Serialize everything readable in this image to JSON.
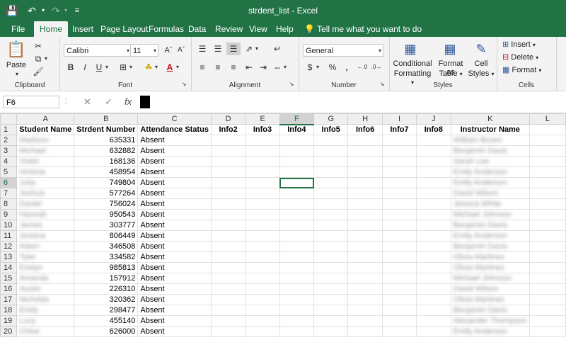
{
  "title": "strdent_list  -  Excel",
  "tabs": [
    "File",
    "Home",
    "Insert",
    "Page Layout",
    "Formulas",
    "Data",
    "Review",
    "View",
    "Help"
  ],
  "active_tab": "Home",
  "tell_me": "Tell me what you want to do",
  "ribbon": {
    "clipboard": {
      "paste": "Paste",
      "label": "Clipboard"
    },
    "font": {
      "name": "Calibri",
      "size": "11",
      "label": "Font"
    },
    "alignment": {
      "label": "Alignment"
    },
    "number": {
      "format": "General",
      "label": "Number",
      "currency": "$",
      "percent": "%",
      "comma": ","
    },
    "styles": {
      "conditional": "Conditional",
      "formatting": "Formatting",
      "format_as": "Format as",
      "table": "Table",
      "cell": "Cell",
      "styles_label": "Styles",
      "label": "Styles"
    },
    "cells": {
      "insert": "Insert",
      "delete": "Delete",
      "format": "Format",
      "label": "Cells"
    }
  },
  "name_box": "F6",
  "columns": [
    "A",
    "B",
    "C",
    "D",
    "E",
    "F",
    "G",
    "H",
    "I",
    "J",
    "K",
    "L"
  ],
  "selected_column": "F",
  "selected_row": 6,
  "headers": [
    "Student Name",
    "Strdent Number",
    "Attendance Status",
    "Info2",
    "Info3",
    "Info4",
    "Info5",
    "Info6",
    "Info7",
    "Info8",
    "Instructor Name",
    ""
  ],
  "rows": [
    {
      "n": 2,
      "name": "Madison",
      "num": "635331",
      "status": "Absent",
      "instr": "William Brown"
    },
    {
      "n": 3,
      "name": "Michael",
      "num": "632882",
      "status": "Absent",
      "instr": "Benjamin Davis"
    },
    {
      "n": 4,
      "name": "Violet",
      "num": "168136",
      "status": "Absent",
      "instr": "Sarah Lee"
    },
    {
      "n": 5,
      "name": "Victoria",
      "num": "458954",
      "status": "Absent",
      "instr": "Emily Anderson"
    },
    {
      "n": 6,
      "name": "Julia",
      "num": "749804",
      "status": "Absent",
      "instr": "Emily Anderson"
    },
    {
      "n": 7,
      "name": "Joshua",
      "num": "577264",
      "status": "Absent",
      "instr": "David Wilson"
    },
    {
      "n": 8,
      "name": "Daniel",
      "num": "756024",
      "status": "Absent",
      "instr": "Jessica White"
    },
    {
      "n": 9,
      "name": "Hannah",
      "num": "950543",
      "status": "Absent",
      "instr": "Michael Johnson"
    },
    {
      "n": 10,
      "name": "James",
      "num": "303777",
      "status": "Absent",
      "instr": "Benjamin Davis"
    },
    {
      "n": 11,
      "name": "Jessica",
      "num": "806449",
      "status": "Absent",
      "instr": "Emily Anderson"
    },
    {
      "n": 12,
      "name": "Adam",
      "num": "346508",
      "status": "Absent",
      "instr": "Benjamin Davis"
    },
    {
      "n": 13,
      "name": "Tyler",
      "num": "334582",
      "status": "Absent",
      "instr": "Olivia Martinez"
    },
    {
      "n": 14,
      "name": "Evelyn",
      "num": "985813",
      "status": "Absent",
      "instr": "Olivia Martinez"
    },
    {
      "n": 15,
      "name": "Amanda",
      "num": "157912",
      "status": "Absent",
      "instr": "Michael Johnson"
    },
    {
      "n": 16,
      "name": "Austin",
      "num": "226310",
      "status": "Absent",
      "instr": "David Wilson"
    },
    {
      "n": 17,
      "name": "Nicholas",
      "num": "320362",
      "status": "Absent",
      "instr": "Olivia Martinez"
    },
    {
      "n": 18,
      "name": "Emily",
      "num": "298477",
      "status": "Absent",
      "instr": "Benjamin Davis"
    },
    {
      "n": 19,
      "name": "Lucy",
      "num": "455140",
      "status": "Absent",
      "instr": "Alexander Thompson"
    },
    {
      "n": 20,
      "name": "Chloe",
      "num": "626000",
      "status": "Absent",
      "instr": "Emily Anderson"
    }
  ],
  "colors": {
    "accent": "#217346"
  }
}
